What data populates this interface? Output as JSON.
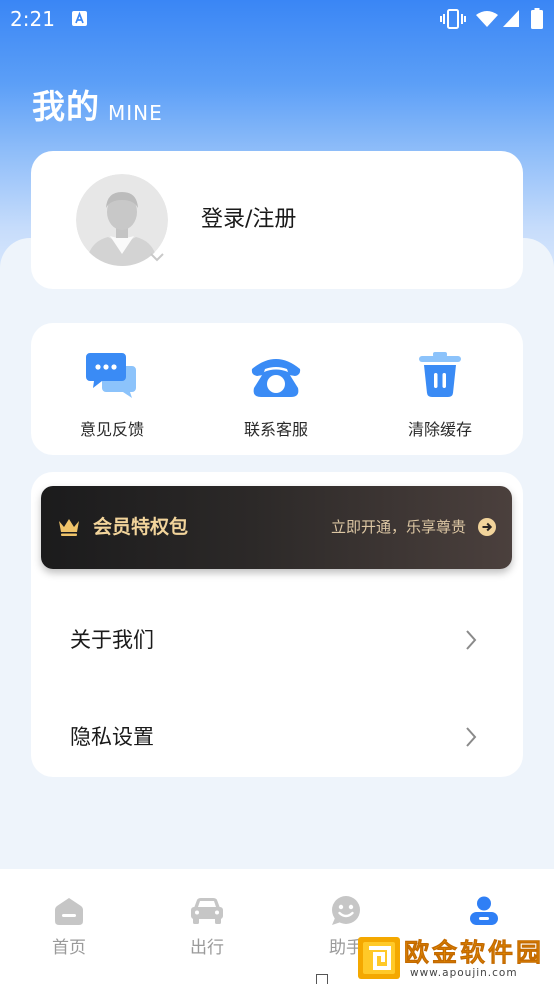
{
  "status_bar": {
    "time": "2:21",
    "notification_icon": "a-notification-icon",
    "icons": [
      "vibrate-icon",
      "wifi-icon",
      "signal-icon",
      "battery-icon"
    ]
  },
  "header": {
    "title": "我的",
    "subtitle": "MINE"
  },
  "profile": {
    "avatar_icon": "default-avatar-icon",
    "login_label": "登录/注册"
  },
  "quick_actions": [
    {
      "label": "意见反馈",
      "icon": "feedback-chat-icon"
    },
    {
      "label": "联系客服",
      "icon": "phone-icon"
    },
    {
      "label": "清除缓存",
      "icon": "trash-icon"
    }
  ],
  "vip_banner": {
    "icon": "crown-icon",
    "title": "会员特权包",
    "cta": "立即开通，乐享尊贵",
    "cta_icon": "arrow-circle-right-icon"
  },
  "menu": [
    {
      "label": "关于我们",
      "icon": "chevron-right-icon"
    },
    {
      "label": "隐私设置",
      "icon": "chevron-right-icon"
    }
  ],
  "bottom_nav": {
    "items": [
      {
        "label": "首页",
        "icon": "home-icon",
        "active": false
      },
      {
        "label": "出行",
        "icon": "car-icon",
        "active": false
      },
      {
        "label": "助手",
        "icon": "assistant-icon",
        "active": false
      },
      {
        "label": "",
        "icon": "user-icon",
        "active": true
      }
    ]
  },
  "watermark": {
    "name": "欧金软件园",
    "url": "www.apoujin.com"
  },
  "colors": {
    "primary": "#2f7ff5",
    "header_top": "#3a86f5",
    "background": "#eef4fb",
    "vip_gold": "#f2d49b",
    "inactive": "#c6c6c6"
  }
}
